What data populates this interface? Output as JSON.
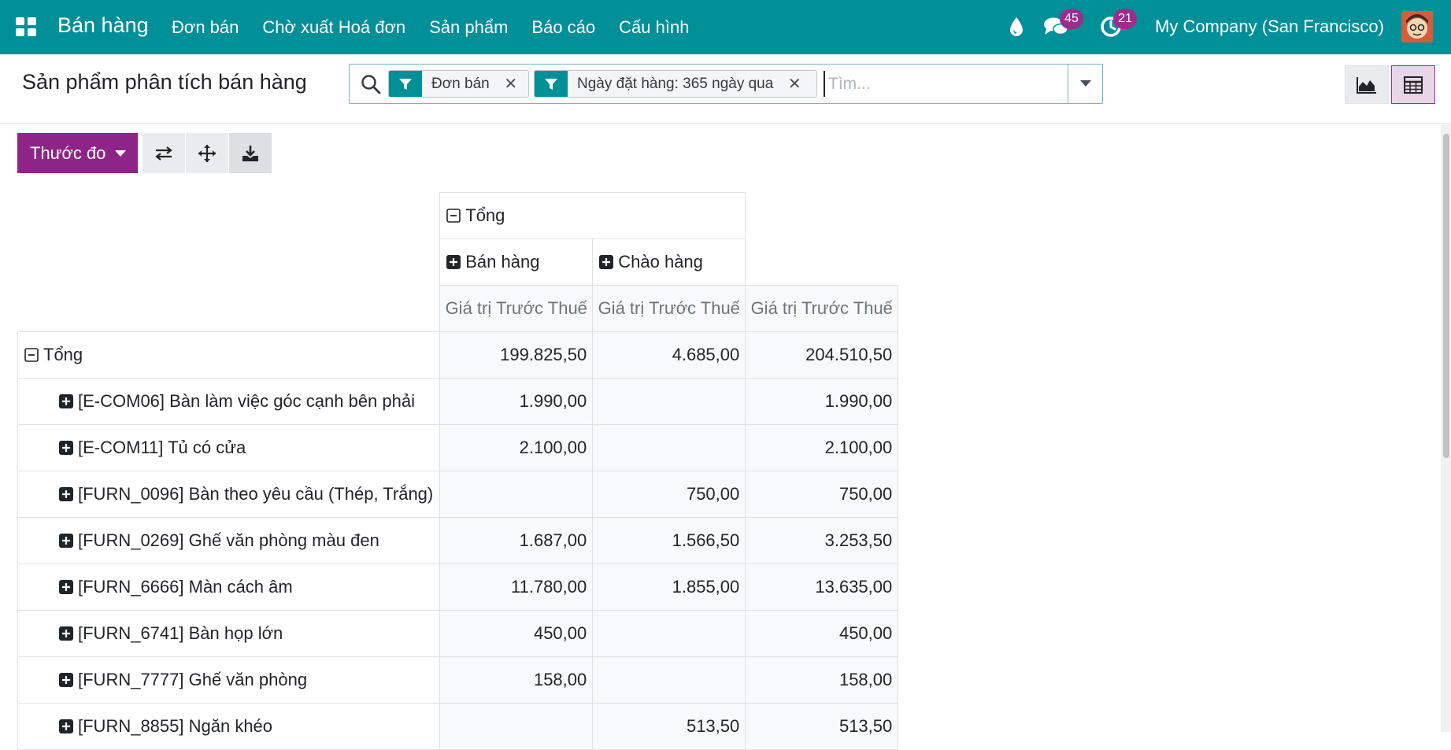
{
  "navbar": {
    "app_name": "Bán hàng",
    "menu": [
      "Đơn bán",
      "Chờ xuất Hoá đơn",
      "Sản phẩm",
      "Báo cáo",
      "Cấu hình"
    ],
    "messages_count": "45",
    "activities_count": "21",
    "company": "My Company (San Francisco)"
  },
  "control": {
    "title": "Sản phẩm phân tích bán hàng",
    "facets": [
      "Đơn bán",
      "Ngày đặt hàng: 365 ngày qua"
    ],
    "search_placeholder": "Tìm..."
  },
  "toolbar": {
    "measures_label": "Thước đo"
  },
  "pivot": {
    "col_total": "Tổng",
    "col_groups": [
      "Bán hàng",
      "Chào hàng"
    ],
    "measure": "Giá trị Trước Thuế",
    "row_total_label": "Tổng",
    "total_row": [
      "199.825,50",
      "4.685,00",
      "204.510,50"
    ],
    "rows": [
      {
        "label": "[E-COM06] Bàn làm việc góc cạnh bên phải",
        "values": [
          "1.990,00",
          "",
          "1.990,00"
        ]
      },
      {
        "label": "[E-COM11] Tủ có cửa",
        "values": [
          "2.100,00",
          "",
          "2.100,00"
        ]
      },
      {
        "label": "[FURN_0096] Bàn theo yêu cầu (Thép, Trắng)",
        "values": [
          "",
          "750,00",
          "750,00"
        ]
      },
      {
        "label": "[FURN_0269] Ghế văn phòng màu đen",
        "values": [
          "1.687,00",
          "1.566,50",
          "3.253,50"
        ]
      },
      {
        "label": "[FURN_6666] Màn cách âm",
        "values": [
          "11.780,00",
          "1.855,00",
          "13.635,00"
        ]
      },
      {
        "label": "[FURN_6741] Bàn họp lớn",
        "values": [
          "450,00",
          "",
          "450,00"
        ]
      },
      {
        "label": "[FURN_7777] Ghế văn phòng",
        "values": [
          "158,00",
          "",
          "158,00"
        ]
      },
      {
        "label": "[FURN_8855] Ngăn khéo",
        "values": [
          "",
          "513,50",
          "513,50"
        ]
      }
    ]
  },
  "colors": {
    "navbar": "#018f98",
    "primary": "#8f2488",
    "badge": "#9b2d8e"
  }
}
